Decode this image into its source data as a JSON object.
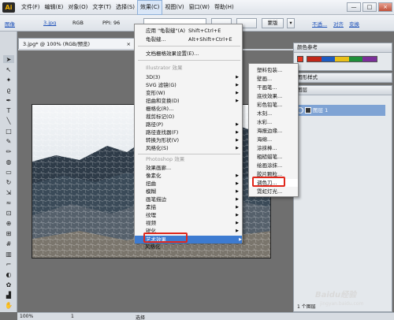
{
  "app": {
    "logo": "Ai"
  },
  "menubar": [
    "文件(F)",
    "编辑(E)",
    "对象(O)",
    "文字(T)",
    "选择(S)",
    "效果(C)",
    "视图(V)",
    "窗口(W)",
    "帮助(H)"
  ],
  "window_buttons": [
    "—",
    "□",
    "×"
  ],
  "control_bar": {
    "object_type": "图像",
    "filename": "3.jpg",
    "color_mode": "RGB",
    "ppi": "PPI: 96",
    "trace_button": "蒙版",
    "opacity_label": "不透...",
    "recolor_label": "对齐",
    "transform_label": "变换"
  },
  "document_tab": {
    "title": "3.jpg* @ 100% (RGB/预览)",
    "close": "×"
  },
  "effect_menu": {
    "apply": {
      "label": "应用 \"龟裂缝\"(A)",
      "shortcut": "Shift+Ctrl+E"
    },
    "last": {
      "label": "龟裂缝...",
      "shortcut": "Alt+Shift+Ctrl+E"
    },
    "doc_raster": "文档栅格效果设置(E)...",
    "illustrator_header": "Illustrator 效果",
    "illustrator_items": [
      "3D(3)",
      "SVG 滤镜(G)",
      "变形(W)",
      "扭曲和变换(D)",
      "栅格化(R)...",
      "裁剪标记(O)",
      "路径(P)",
      "路径查找器(F)",
      "转换为形状(V)",
      "风格化(S)"
    ],
    "photoshop_header": "Photoshop 效果",
    "photoshop_items": [
      "效果画廊...",
      "像素化",
      "扭曲",
      "模糊",
      "画笔描边",
      "素描",
      "纹理",
      "艺术效果",
      "视频",
      "锐化",
      "风格化"
    ]
  },
  "artistic_submenu": [
    "塑料包装...",
    "壁画...",
    "干画笔...",
    "底纹效果...",
    "彩色铅笔...",
    "木刻...",
    "水彩...",
    "海报边缘...",
    "海绵...",
    "涂抹棒...",
    "粗糙蜡笔...",
    "绘画涂抹...",
    "胶片颗粒...",
    "调色刀...",
    "霓虹灯光..."
  ],
  "panels": {
    "color_tabs": "颜色参考",
    "style_tab": "图形样式",
    "layers_tab": "图层",
    "layer_name": "图层 1",
    "layer_count": "1 个图层"
  },
  "status_bar": {
    "zoom": "100%",
    "page": "1",
    "tool": "选择"
  },
  "watermark": {
    "line1": "Baidu经验",
    "line2": "jingyan.baidu.com"
  }
}
